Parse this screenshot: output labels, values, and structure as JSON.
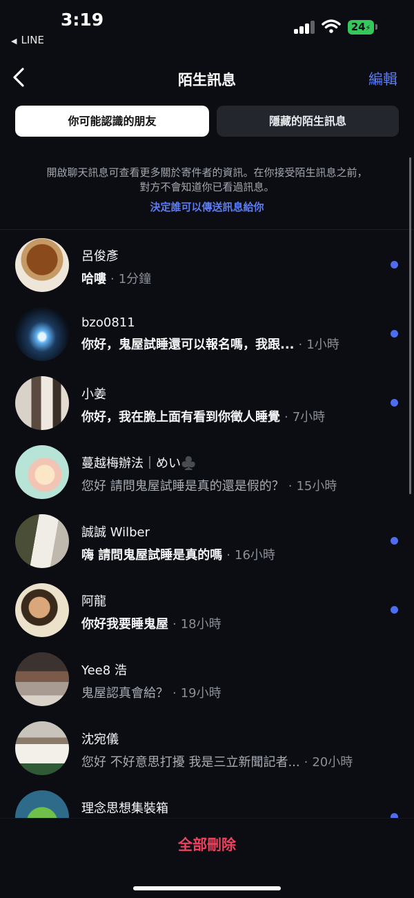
{
  "status_bar": {
    "time": "3:19",
    "back_app": "LINE",
    "battery": "24"
  },
  "nav": {
    "title": "陌生訊息",
    "edit_label": "編輯"
  },
  "tabs": [
    {
      "label": "你可能認識的朋友",
      "active": true
    },
    {
      "label": "隱藏的陌生訊息",
      "active": false
    }
  ],
  "info": {
    "line1": "開啟聊天訊息可查看更多關於寄件者的資訊。在你接受陌生訊息之前，",
    "line2": "對方不會知道你已看過訊息。",
    "link": "決定誰可以傳送訊息給你"
  },
  "messages": [
    {
      "name": "呂俊彥",
      "preview": "哈嘍",
      "separator": "·",
      "time": "1分鐘",
      "unread": true
    },
    {
      "name": "bzo0811",
      "preview": "你好，鬼屋試睡還可以報名嗎，我跟...",
      "separator": "·",
      "time": "1小時",
      "unread": true
    },
    {
      "name": "小姜",
      "preview": "你好，我在脆上面有看到你徵人睡覺",
      "separator": "·",
      "time": "7小時",
      "unread": true
    },
    {
      "name": "蔓越梅辦法｜めい♣️",
      "preview": "您好 請問鬼屋試睡是真的還是假的？",
      "separator": "·",
      "time": "15小時",
      "unread": false
    },
    {
      "name": "誠誠 Wilber",
      "preview": "嗨 請問鬼屋試睡是真的嗎",
      "separator": "·",
      "time": "16小時",
      "unread": true
    },
    {
      "name": "阿龍",
      "preview": "你好我要睡鬼屋",
      "separator": "·",
      "time": "18小時",
      "unread": true
    },
    {
      "name": "Yee8 浩",
      "preview": "鬼屋認真會給？",
      "separator": "·",
      "time": "19小時",
      "unread": false
    },
    {
      "name": "沈宛儀",
      "preview": "您好 不好意思打擾 我是三立新聞記者...",
      "separator": "·",
      "time": "20小時",
      "unread": false
    },
    {
      "name": "理念思想集裝箱",
      "preview": "",
      "separator": "",
      "time": "",
      "unread": true
    }
  ],
  "bottom": {
    "delete_all": "全部刪除"
  },
  "colors": {
    "accent": "#5b7cf5",
    "unread_dot": "#4e6cf0",
    "danger": "#f0415e",
    "background": "#0b0d12"
  }
}
